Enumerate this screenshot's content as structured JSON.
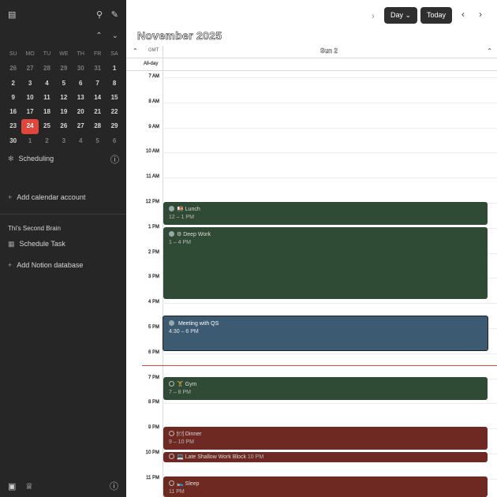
{
  "sidebar": {
    "mini_calendar": {
      "weekday_headers": [
        "SU",
        "MO",
        "TU",
        "WE",
        "TH",
        "FR",
        "SA"
      ],
      "weeks": [
        [
          {
            "d": "26",
            "dim": true
          },
          {
            "d": "27",
            "dim": true
          },
          {
            "d": "28",
            "dim": true
          },
          {
            "d": "29",
            "dim": true
          },
          {
            "d": "30",
            "dim": true
          },
          {
            "d": "31",
            "dim": true
          },
          {
            "d": "1"
          }
        ],
        [
          {
            "d": "2"
          },
          {
            "d": "3"
          },
          {
            "d": "4"
          },
          {
            "d": "5"
          },
          {
            "d": "6"
          },
          {
            "d": "7"
          },
          {
            "d": "8"
          }
        ],
        [
          {
            "d": "9"
          },
          {
            "d": "10"
          },
          {
            "d": "11"
          },
          {
            "d": "12"
          },
          {
            "d": "13"
          },
          {
            "d": "14"
          },
          {
            "d": "15"
          }
        ],
        [
          {
            "d": "16"
          },
          {
            "d": "17"
          },
          {
            "d": "18"
          },
          {
            "d": "19"
          },
          {
            "d": "20"
          },
          {
            "d": "21"
          },
          {
            "d": "22"
          }
        ],
        [
          {
            "d": "23"
          },
          {
            "d": "24",
            "today": true
          },
          {
            "d": "25"
          },
          {
            "d": "26"
          },
          {
            "d": "27"
          },
          {
            "d": "28"
          },
          {
            "d": "29"
          }
        ],
        [
          {
            "d": "30"
          },
          {
            "d": "1",
            "dim": true
          },
          {
            "d": "2",
            "dim": true
          },
          {
            "d": "3",
            "dim": true
          },
          {
            "d": "4",
            "dim": true
          },
          {
            "d": "5",
            "dim": true
          },
          {
            "d": "6",
            "dim": true
          }
        ]
      ]
    },
    "scheduling_label": "Scheduling",
    "add_calendar_label": "Add calendar account",
    "section_title": "Thi's Second Brain",
    "schedule_item": "Schedule Task",
    "add_database_label": "Add Notion database"
  },
  "toolbar": {
    "view_label": "Day",
    "today_label": "Today",
    "prev_icon": "chevron-left-icon",
    "next_icon": "chevron-right-icon"
  },
  "title": "November 2025",
  "day_header": {
    "label": "Sun 2",
    "tz_label": "GMT",
    "all_day_label": "All-day"
  },
  "hours": [
    "7 AM",
    "8 AM",
    "9 AM",
    "10 AM",
    "11 AM",
    "12 PM",
    "1 PM",
    "2 PM",
    "3 PM",
    "4 PM",
    "5 PM",
    "6 PM",
    "7 PM",
    "8 PM",
    "9 PM",
    "10 PM",
    "11 PM"
  ],
  "events": [
    {
      "title": "🍱 Lunch",
      "time": "12 – 1 PM",
      "color": "#2f4a35",
      "done": true
    },
    {
      "title": "⚙ Deep Work",
      "time": "1 – 4 PM",
      "color": "#2f4a35",
      "done": true
    },
    {
      "title": "Meeting with QS",
      "time": "4:30 – 6 PM",
      "color": "#3d5a73",
      "done": true
    },
    {
      "title": "🏋 Gym",
      "time": "7 – 8 PM",
      "color": "#2f4a35",
      "done": false
    },
    {
      "title": "🍽 Dinner",
      "time": "9 – 10 PM",
      "color": "#6e2a22",
      "done": false
    },
    {
      "title": "💻 Late Shallow Work Block",
      "time": "10 PM",
      "color": "#6e2a22",
      "done": false
    },
    {
      "title": "🛌 Sleep",
      "time": "11 PM",
      "color": "#6e2a22",
      "done": false
    }
  ]
}
